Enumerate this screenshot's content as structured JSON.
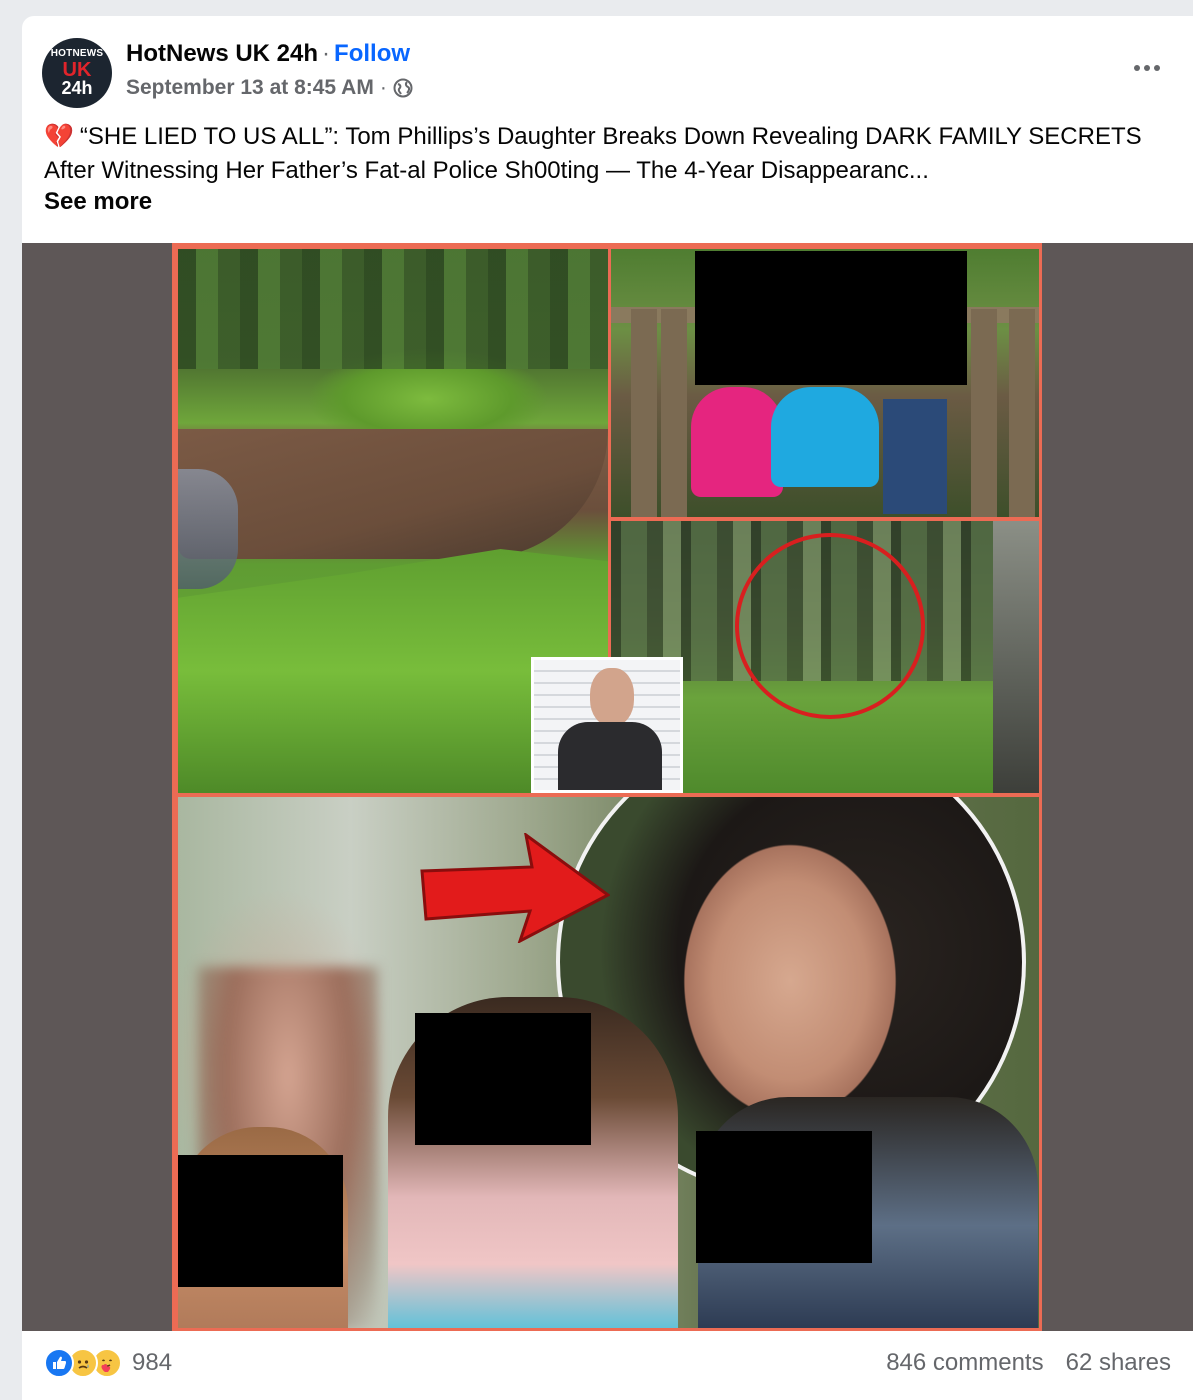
{
  "post": {
    "avatar": {
      "line1": "HOTNEWS",
      "line2": "UK",
      "line3": "24h"
    },
    "page_name": "HotNews UK 24h",
    "separator": "·",
    "follow_label": "Follow",
    "timestamp": "September 13 at 8:45 AM",
    "meta_separator": "·",
    "audience_icon": "globe-icon",
    "more_icon": "more-horizontal-icon",
    "text": "“SHE LIED TO US ALL”: Tom Phillips’s Daughter Breaks Down Revealing DARK FAMILY SECRETS After Witnessing Her Father’s Fat-al Police Sh00ting — The 4-Year Disappearanc...",
    "text_emoji": "💔",
    "see_more_label": "See more"
  },
  "footer": {
    "reactions": [
      "like-icon",
      "sad-icon",
      "care-icon"
    ],
    "reaction_count": "984",
    "comments": "846 comments",
    "shares": "62 shares"
  },
  "colors": {
    "link_blue": "#0866ff",
    "meta_gray": "#65676b",
    "collage_border": "#ec6b54",
    "image_bg": "#5e5757",
    "circle_red": "#d81f1f"
  }
}
